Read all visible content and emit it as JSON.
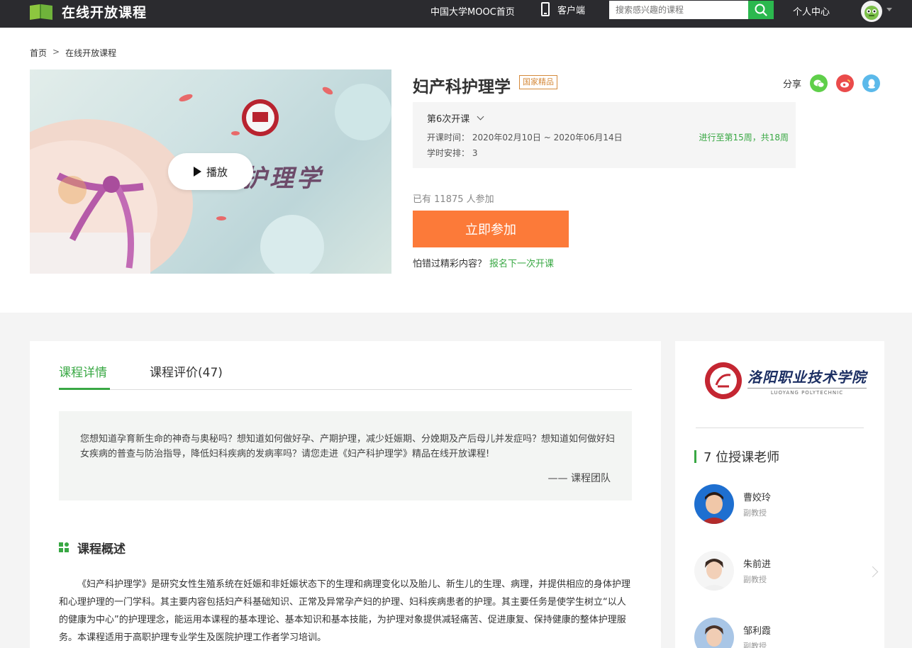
{
  "nav": {
    "logo_text": "在线开放课程",
    "mooc_link": "中国大学MOOC首页",
    "client_link": "客户端",
    "search_placeholder": "搜索感兴趣的课程",
    "personal_center": "个人中心"
  },
  "breadcrumb": {
    "home": "首页",
    "separator": ">",
    "current": "在线开放课程"
  },
  "course": {
    "title": "妇产科护理学",
    "badge": "国家精品",
    "cover_title": "护理学",
    "play_label": "播放",
    "share_label": "分享",
    "share_icons": [
      "wechat-icon",
      "weibo-icon",
      "qq-icon"
    ],
    "session": {
      "selected": "第6次开课",
      "time_label": "开课时间：",
      "time_value": "2020年02月10日 ~ 2020年06月14日",
      "hours_label": "学时安排：",
      "hours_value": "3",
      "progress": "进行至第15周，共18周"
    },
    "enroll_prefix": "已有",
    "enroll_count": "11875",
    "enroll_suffix": "人参加",
    "join_label": "立即参加",
    "miss_text": "怕错过精彩内容？",
    "miss_link": "报名下一次开课"
  },
  "tabs": [
    {
      "label": "课程详情",
      "active": true
    },
    {
      "label": "课程评价(47)",
      "active": false
    }
  ],
  "intro": {
    "quote": "您想知道孕育新生命的神奇与奥秘吗？想知道如何做好孕、产期护理，减少妊娠期、分娩期及产后母儿并发症吗？想知道如何做好妇女疾病的普查与防治指导，降低妇科疾病的发病率吗？请您走进《妇产科护理学》精品在线开放课程!",
    "signature": "—— 课程团队"
  },
  "overview": {
    "heading": "课程概述",
    "text": "《妇产科护理学》是研究女性生殖系统在妊娠和非妊娠状态下的生理和病理变化以及胎儿、新生儿的生理、病理，并提供相应的身体护理和心理护理的一门学科。其主要内容包括妇产科基础知识、正常及异常孕产妇的护理、妇科疾病患者的护理。其主要任务是使学生树立“以人的健康为中心”的护理理念，能运用本课程的基本理论、基本知识和基本技能，为护理对象提供减轻痛苦、促进康复、保持健康的整体护理服务。本课程适用于高职护理专业学生及医院护理工作者学习培训。"
  },
  "school": {
    "name": "洛阳职业技术学院",
    "name_en": "LUOYANG POLYTECHNIC"
  },
  "teachers": {
    "count_label": "7 位授课老师",
    "list": [
      {
        "name": "曹姣玲",
        "title": "副教授"
      },
      {
        "name": "朱前进",
        "title": "副教授"
      },
      {
        "name": "邹利霞",
        "title": "副教授"
      }
    ]
  },
  "colors": {
    "accent_green": "#39a844",
    "join_orange": "#fc7a39",
    "nav_bg": "#2b2b2f",
    "badge_orange": "#d58a3b"
  }
}
